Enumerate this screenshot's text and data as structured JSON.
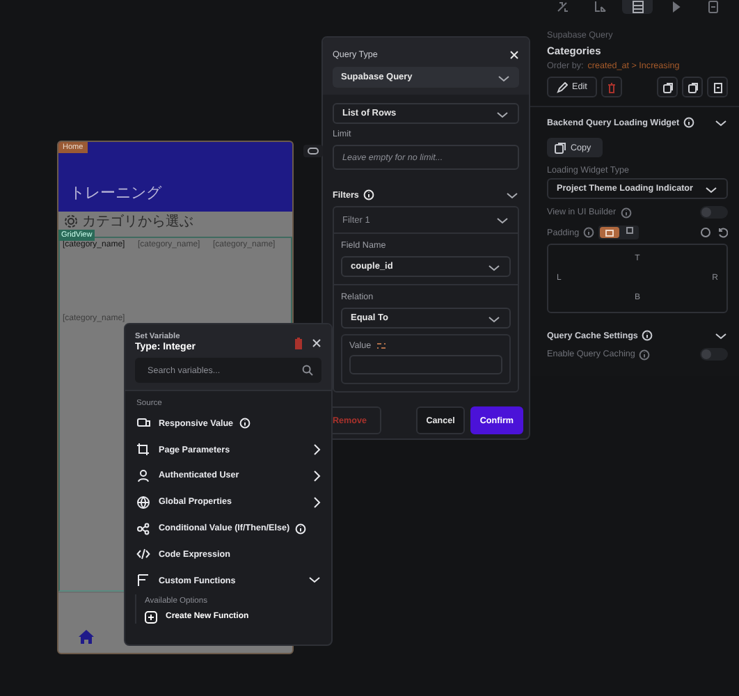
{
  "phone": {
    "page_tag": "Home",
    "title": "トレーニング",
    "section_label": "カテゴリから選ぶ",
    "grid_tag": "GridView",
    "grid_items": [
      {
        "label": "[category_name]",
        "selected": true
      },
      {
        "label": "[category_name]",
        "selected": false
      },
      {
        "label": "[category_name]",
        "selected": false
      },
      {
        "label": "[category_name]",
        "selected": false
      }
    ]
  },
  "query_panel": {
    "title": "Query Type",
    "query_type": "Supabase Query",
    "query_kind": "List of Rows",
    "limit_label": "Limit",
    "limit_placeholder": "Leave empty for no limit...",
    "filters_label": "Filters",
    "filter": {
      "title": "Filter 1",
      "field_label": "Field Name",
      "field_value": "couple_id",
      "relation_label": "Relation",
      "relation_value": "Equal To",
      "value_label": "Value"
    },
    "buttons": [
      {
        "label": "Remove",
        "kind": "danger"
      },
      {
        "label": "Cancel",
        "kind": "plain"
      },
      {
        "label": "Confirm",
        "kind": "primary"
      }
    ]
  },
  "properties": {
    "tabs": [
      {
        "selected": false
      },
      {
        "selected": false
      },
      {
        "selected": true
      },
      {
        "selected": false
      },
      {
        "selected": false
      }
    ],
    "subtitle": "Supabase Query",
    "title": "Categories",
    "order_label": "Order by:",
    "order_value": "created_at > Increasing",
    "edit_button": "Edit",
    "loading_section": "Backend Query Loading Widget",
    "copy_button": "Copy",
    "loading_type_label": "Loading Widget Type",
    "loading_type": "Project Theme Loading Indicator",
    "view_in_builder": {
      "label": "View in UI Builder",
      "on": false
    },
    "padding_label": "Padding",
    "padding": {
      "top": "T",
      "left": "L",
      "right": "R",
      "bottom": "B"
    },
    "cache_section": "Query Cache Settings",
    "cache_toggle": {
      "label": "Enable Query Caching",
      "on": false
    }
  },
  "set_variable": {
    "title": "Set Variable",
    "type": "Type: Integer",
    "search_placeholder": "Search variables...",
    "source_label": "Source",
    "items": [
      {
        "label": "Responsive Value",
        "kind": "info"
      },
      {
        "label": "Page Parameters",
        "kind": "chevron"
      },
      {
        "label": "Authenticated User",
        "kind": "chevron"
      },
      {
        "label": "Global Properties",
        "kind": "chevron"
      },
      {
        "label": "Conditional Value (If/Then/Else)",
        "kind": "info"
      },
      {
        "label": "Code Expression",
        "kind": "plain"
      },
      {
        "label": "Custom Functions",
        "kind": "expand",
        "expanded": true
      }
    ],
    "available_label": "Available Options",
    "create_label": "Create New Function"
  }
}
